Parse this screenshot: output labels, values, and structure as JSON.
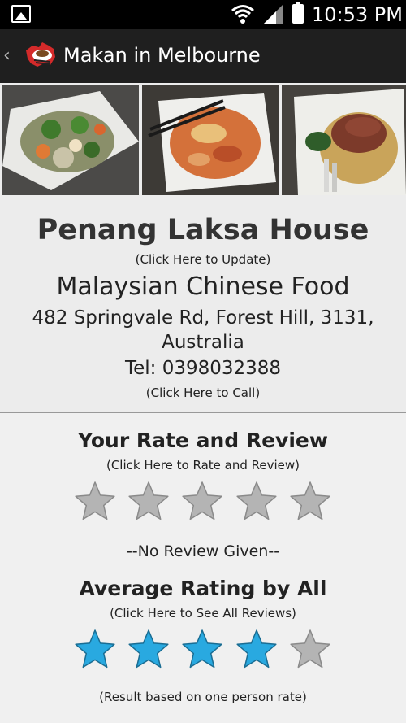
{
  "status_bar": {
    "time": "10:53 PM",
    "icons": [
      "gallery-icon",
      "wifi-icon",
      "signal-icon",
      "battery-icon"
    ]
  },
  "action_bar": {
    "title": "Makan in Melbourne",
    "icons": [
      "up-caret-icon",
      "app-logo"
    ]
  },
  "photos": [
    {
      "subject": "stir-fried vegetables with prawns"
    },
    {
      "subject": "laksa noodle soup"
    },
    {
      "subject": "roast duck with noodles"
    }
  ],
  "restaurant": {
    "name": "Penang Laksa House",
    "update_hint": "(Click Here to Update)",
    "cuisine": "Malaysian Chinese Food",
    "address": "482 Springvale Rd, Forest Hill, 3131, Australia",
    "phone": "Tel: 0398032388",
    "call_hint": "(Click Here to Call)"
  },
  "your_review": {
    "title": "Your Rate and Review",
    "hint": "(Click Here to Rate and Review)",
    "rating": 0,
    "max_rating": 5,
    "status": "--No Review Given--"
  },
  "average_rating": {
    "title": "Average Rating by All",
    "hint": "(Click Here to See All Reviews)",
    "rating": 4,
    "max_rating": 5,
    "footnote": "(Result based on one person rate)"
  },
  "colors": {
    "star_filled": "#29a9e0",
    "star_empty": "#b4b4b4",
    "action_bar": "#1f1f1f",
    "status_bar": "#000000"
  }
}
